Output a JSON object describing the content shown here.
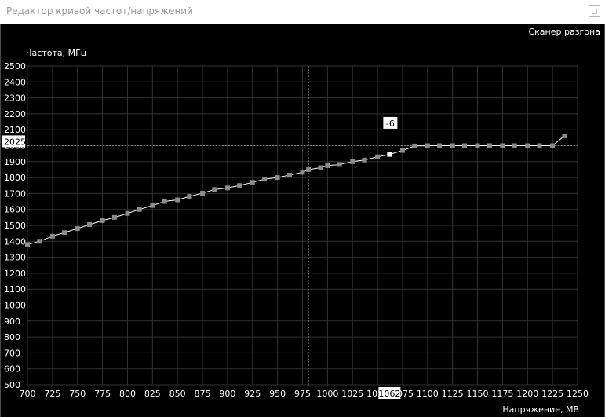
{
  "window": {
    "title": "Редактор кривой частот/напряжений"
  },
  "toolbar": {
    "scanner_label": "Сканер разгона"
  },
  "colors": {
    "background": "#000000",
    "grid": "#333333",
    "curve": "#ffffff",
    "point": "#8c8c8c",
    "selected_point": "#ffffff",
    "guide": "#808080"
  },
  "chart_data": {
    "type": "line",
    "ylabel": "Частота, МГц",
    "xlabel": "Напряжение, МВ",
    "xlim": [
      700,
      1250
    ],
    "ylim": [
      500,
      2500
    ],
    "x_ticks": [
      "700",
      "725",
      "750",
      "775",
      "800",
      "825",
      "850",
      "875",
      "900",
      "925",
      "950",
      "975",
      "1000",
      "1025",
      "1050",
      "1075",
      "1100",
      "1125",
      "1150",
      "1175",
      "1200",
      "1225",
      "1250"
    ],
    "y_ticks": [
      "500",
      "600",
      "700",
      "800",
      "900",
      "1000",
      "1100",
      "1200",
      "1300",
      "1400",
      "1500",
      "1600",
      "1700",
      "1800",
      "1900",
      "2000",
      "2100",
      "2200",
      "2300",
      "2400",
      "2500"
    ],
    "markers": {
      "x_value_label": "1062",
      "y_value_label": "2025",
      "offset_label": "-6",
      "x_guide": 981,
      "y_guide": 2000
    },
    "series": [
      {
        "kind": "curve_points",
        "x": [
          700,
          712,
          725,
          737,
          750,
          762,
          775,
          787,
          800,
          812,
          825,
          837,
          850,
          862,
          875,
          887,
          900,
          912,
          925,
          937,
          950,
          962,
          975,
          981,
          993,
          1000,
          1012,
          1025,
          1037,
          1050,
          1062,
          1075,
          1087,
          1100,
          1112,
          1125,
          1137,
          1150,
          1162,
          1175,
          1187,
          1200,
          1212,
          1225,
          1237
        ],
        "y": [
          1380,
          1400,
          1432,
          1455,
          1480,
          1505,
          1530,
          1550,
          1575,
          1600,
          1625,
          1650,
          1660,
          1682,
          1702,
          1725,
          1735,
          1750,
          1770,
          1790,
          1800,
          1815,
          1833,
          1850,
          1862,
          1875,
          1882,
          1900,
          1910,
          1930,
          1945,
          1970,
          1998,
          2000,
          2000,
          2000,
          2000,
          2000,
          2000,
          2000,
          2000,
          2000,
          2000,
          2000,
          2062
        ]
      }
    ]
  }
}
